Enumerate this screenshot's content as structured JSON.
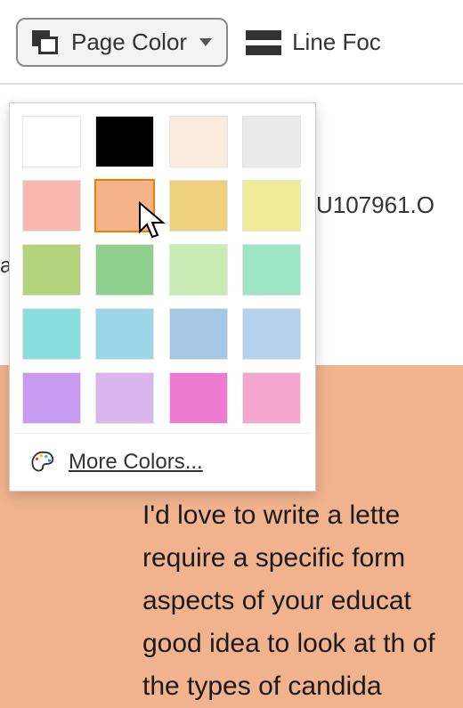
{
  "toolbar": {
    "page_color_label": "Page Color",
    "line_focus_label": "Line Foc"
  },
  "doc": {
    "upper_fragment_1": "a",
    "upper_fragment_2": "U107961.O",
    "body_text": "I'd love to write a lette​ require a specific form aspects of your educat good idea to look at th of the types of candida"
  },
  "dropdown": {
    "swatches": [
      "#ffffff",
      "#000000",
      "#f8eadd",
      "#eaeaea",
      "#f8b7b1",
      "#f6b38a",
      "#eecf7b",
      "#eeec99",
      "#b4d17c",
      "#8fd08e",
      "#c9ecb4",
      "#9de7c4",
      "#8bdede",
      "#9bd6e9",
      "#a6c8e4",
      "#b4d2ec",
      "#c79cf0",
      "#dab6ef",
      "#ef7bd1",
      "#f4a6ce"
    ],
    "selected_index": 5,
    "more_colors_label": "More Colors..."
  }
}
